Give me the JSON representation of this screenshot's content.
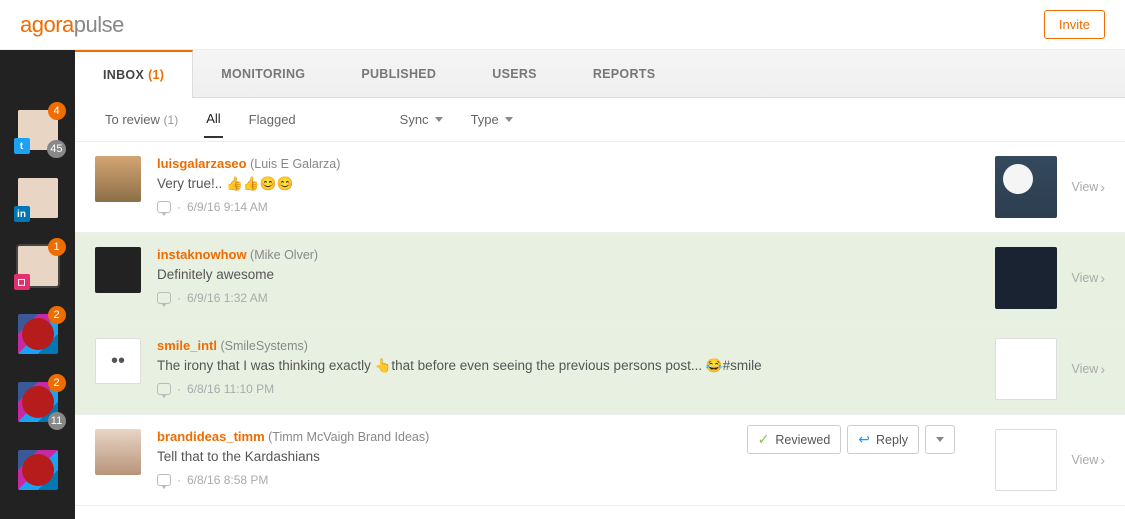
{
  "header": {
    "logo_part1": "agora",
    "logo_part2": "pulse",
    "invite_label": "Invite"
  },
  "sidebar": {
    "accounts": [
      {
        "network": "tw",
        "badge_top": "4",
        "badge_bottom": "45"
      },
      {
        "network": "li"
      },
      {
        "network": "ig",
        "badge_top": "1",
        "active": true
      },
      {
        "network": "multi",
        "badge_top": "2"
      },
      {
        "network": "multi",
        "badge_top": "2",
        "badge_bottom": "11"
      },
      {
        "network": "multi"
      }
    ]
  },
  "tabs": {
    "inbox": {
      "label": "INBOX",
      "count": "(1)"
    },
    "monitoring": "MONITORING",
    "published": "PUBLISHED",
    "users": "USERS",
    "reports": "REPORTS"
  },
  "filters": {
    "to_review": {
      "label": "To review",
      "count": "(1)"
    },
    "all": "All",
    "flagged": "Flagged",
    "sync": "Sync",
    "type": "Type"
  },
  "view_label": "View",
  "action_reviewed": "Reviewed",
  "action_reply": "Reply",
  "messages": [
    {
      "username": "luisgalarzaseo",
      "realname": "(Luis E Galarza)",
      "text": "Very true!.. 👍👍😊😊",
      "time": "6/9/16 9:14 AM",
      "reviewed": false,
      "thumb": "t1"
    },
    {
      "username": "instaknowhow",
      "realname": "(Mike Olver)",
      "text": "Definitely awesome",
      "time": "6/9/16 1:32 AM",
      "reviewed": true,
      "thumb": "t2"
    },
    {
      "username": "smile_intl",
      "realname": "(SmileSystems)",
      "text": "The irony that I was thinking exactly 👆that before even seeing the previous persons post... 😂#smile",
      "time": "6/8/16 11:10 PM",
      "reviewed": true,
      "thumb": "t3"
    },
    {
      "username": "brandideas_timm",
      "realname": "(Timm McVaigh Brand Ideas)",
      "text": "Tell that to the Kardashians",
      "time": "6/8/16 8:58 PM",
      "reviewed": false,
      "show_actions": true,
      "thumb": "t3"
    }
  ]
}
